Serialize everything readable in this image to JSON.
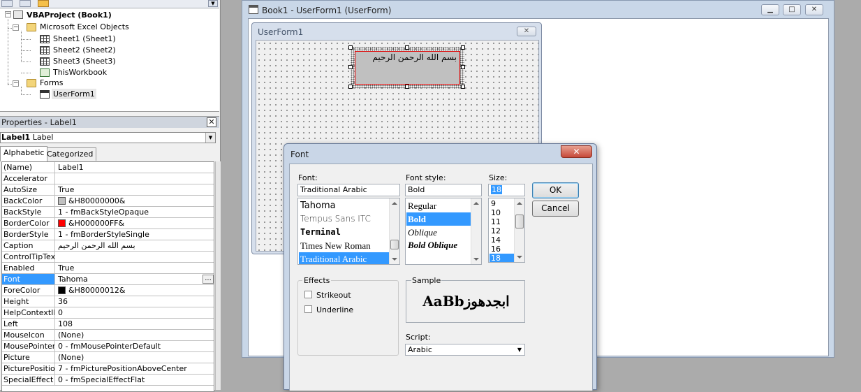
{
  "project": {
    "root": "VBAProject (Book1)",
    "excel_objects": "Microsoft Excel Objects",
    "sheets": [
      "Sheet1 (Sheet1)",
      "Sheet2 (Sheet2)",
      "Sheet3 (Sheet3)"
    ],
    "workbook": "ThisWorkbook",
    "forms": "Forms",
    "form": "UserForm1"
  },
  "properties": {
    "title": "Properties - Label1",
    "object_name": "Label1",
    "object_type": "Label",
    "tabs": [
      "Alphabetic",
      "Categorized"
    ],
    "rows": [
      {
        "name": "(Name)",
        "value": "Label1"
      },
      {
        "name": "Accelerator",
        "value": ""
      },
      {
        "name": "AutoSize",
        "value": "True"
      },
      {
        "name": "BackColor",
        "value": "&H80000000&",
        "color": "#c0c0c0"
      },
      {
        "name": "BackStyle",
        "value": "1 - fmBackStyleOpaque"
      },
      {
        "name": "BorderColor",
        "value": "&H000000FF&",
        "color": "#ff0000"
      },
      {
        "name": "BorderStyle",
        "value": "1 - fmBorderStyleSingle"
      },
      {
        "name": "Caption",
        "value": "بسم الله الرحمن الرحيم"
      },
      {
        "name": "ControlTipText",
        "value": ""
      },
      {
        "name": "Enabled",
        "value": "True"
      },
      {
        "name": "Font",
        "value": "Tahoma",
        "selected": true
      },
      {
        "name": "ForeColor",
        "value": "&H80000012&",
        "color": "#000000"
      },
      {
        "name": "Height",
        "value": "36"
      },
      {
        "name": "HelpContextID",
        "value": "0"
      },
      {
        "name": "Left",
        "value": "108"
      },
      {
        "name": "MouseIcon",
        "value": "(None)"
      },
      {
        "name": "MousePointer",
        "value": "0 - fmMousePointerDefault"
      },
      {
        "name": "Picture",
        "value": "(None)"
      },
      {
        "name": "PicturePosition",
        "value": "7 - fmPicturePositionAboveCenter"
      },
      {
        "name": "SpecialEffect",
        "value": "0 - fmSpecialEffectFlat"
      }
    ]
  },
  "book_window": {
    "title": "Book1 - UserForm1 (UserForm)"
  },
  "userform": {
    "title": "UserForm1",
    "label_caption": "بسم الله الرحمن الرحيم"
  },
  "font_dialog": {
    "title": "Font",
    "font_label": "Font:",
    "font_value": "Traditional Arabic",
    "font_list": [
      "Tahoma",
      "Tempus Sans ITC",
      "Terminal",
      "Times New Roman",
      "Traditional Arabic"
    ],
    "style_label": "Font style:",
    "style_value": "Bold",
    "style_list": [
      "Regular",
      "Bold",
      "Oblique",
      "Bold Oblique"
    ],
    "size_label": "Size:",
    "size_value": "18",
    "size_list": [
      "9",
      "10",
      "11",
      "12",
      "14",
      "16",
      "18"
    ],
    "ok": "OK",
    "cancel": "Cancel",
    "effects_label": "Effects",
    "strikeout": "Strikeout",
    "underline": "Underline",
    "sample_label": "Sample",
    "sample_text": "AaBbابجدهوز",
    "script_label": "Script:",
    "script_value": "Arabic",
    "close_glyph": "✕"
  }
}
